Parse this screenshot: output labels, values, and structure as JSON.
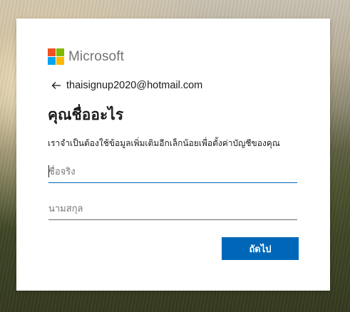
{
  "brand": {
    "name": "Microsoft",
    "logo_colors": {
      "red": "#f25022",
      "green": "#7fba00",
      "blue": "#00a4ef",
      "yellow": "#ffb900"
    },
    "accent": "#0067b8"
  },
  "identity": {
    "back_icon": "arrow-left-icon",
    "email": "thaisignup2020@hotmail.com"
  },
  "page": {
    "title": "คุณชื่ออะไร",
    "description": "เราจำเป็นต้องใช้ข้อมูลเพิ่มเติมอีกเล็กน้อยเพื่อตั้งค่าบัญชีของคุณ"
  },
  "form": {
    "first_name": {
      "placeholder": "ชื่อจริง",
      "value": ""
    },
    "last_name": {
      "placeholder": "นามสกุล",
      "value": ""
    },
    "next_label": "ถัดไป"
  }
}
